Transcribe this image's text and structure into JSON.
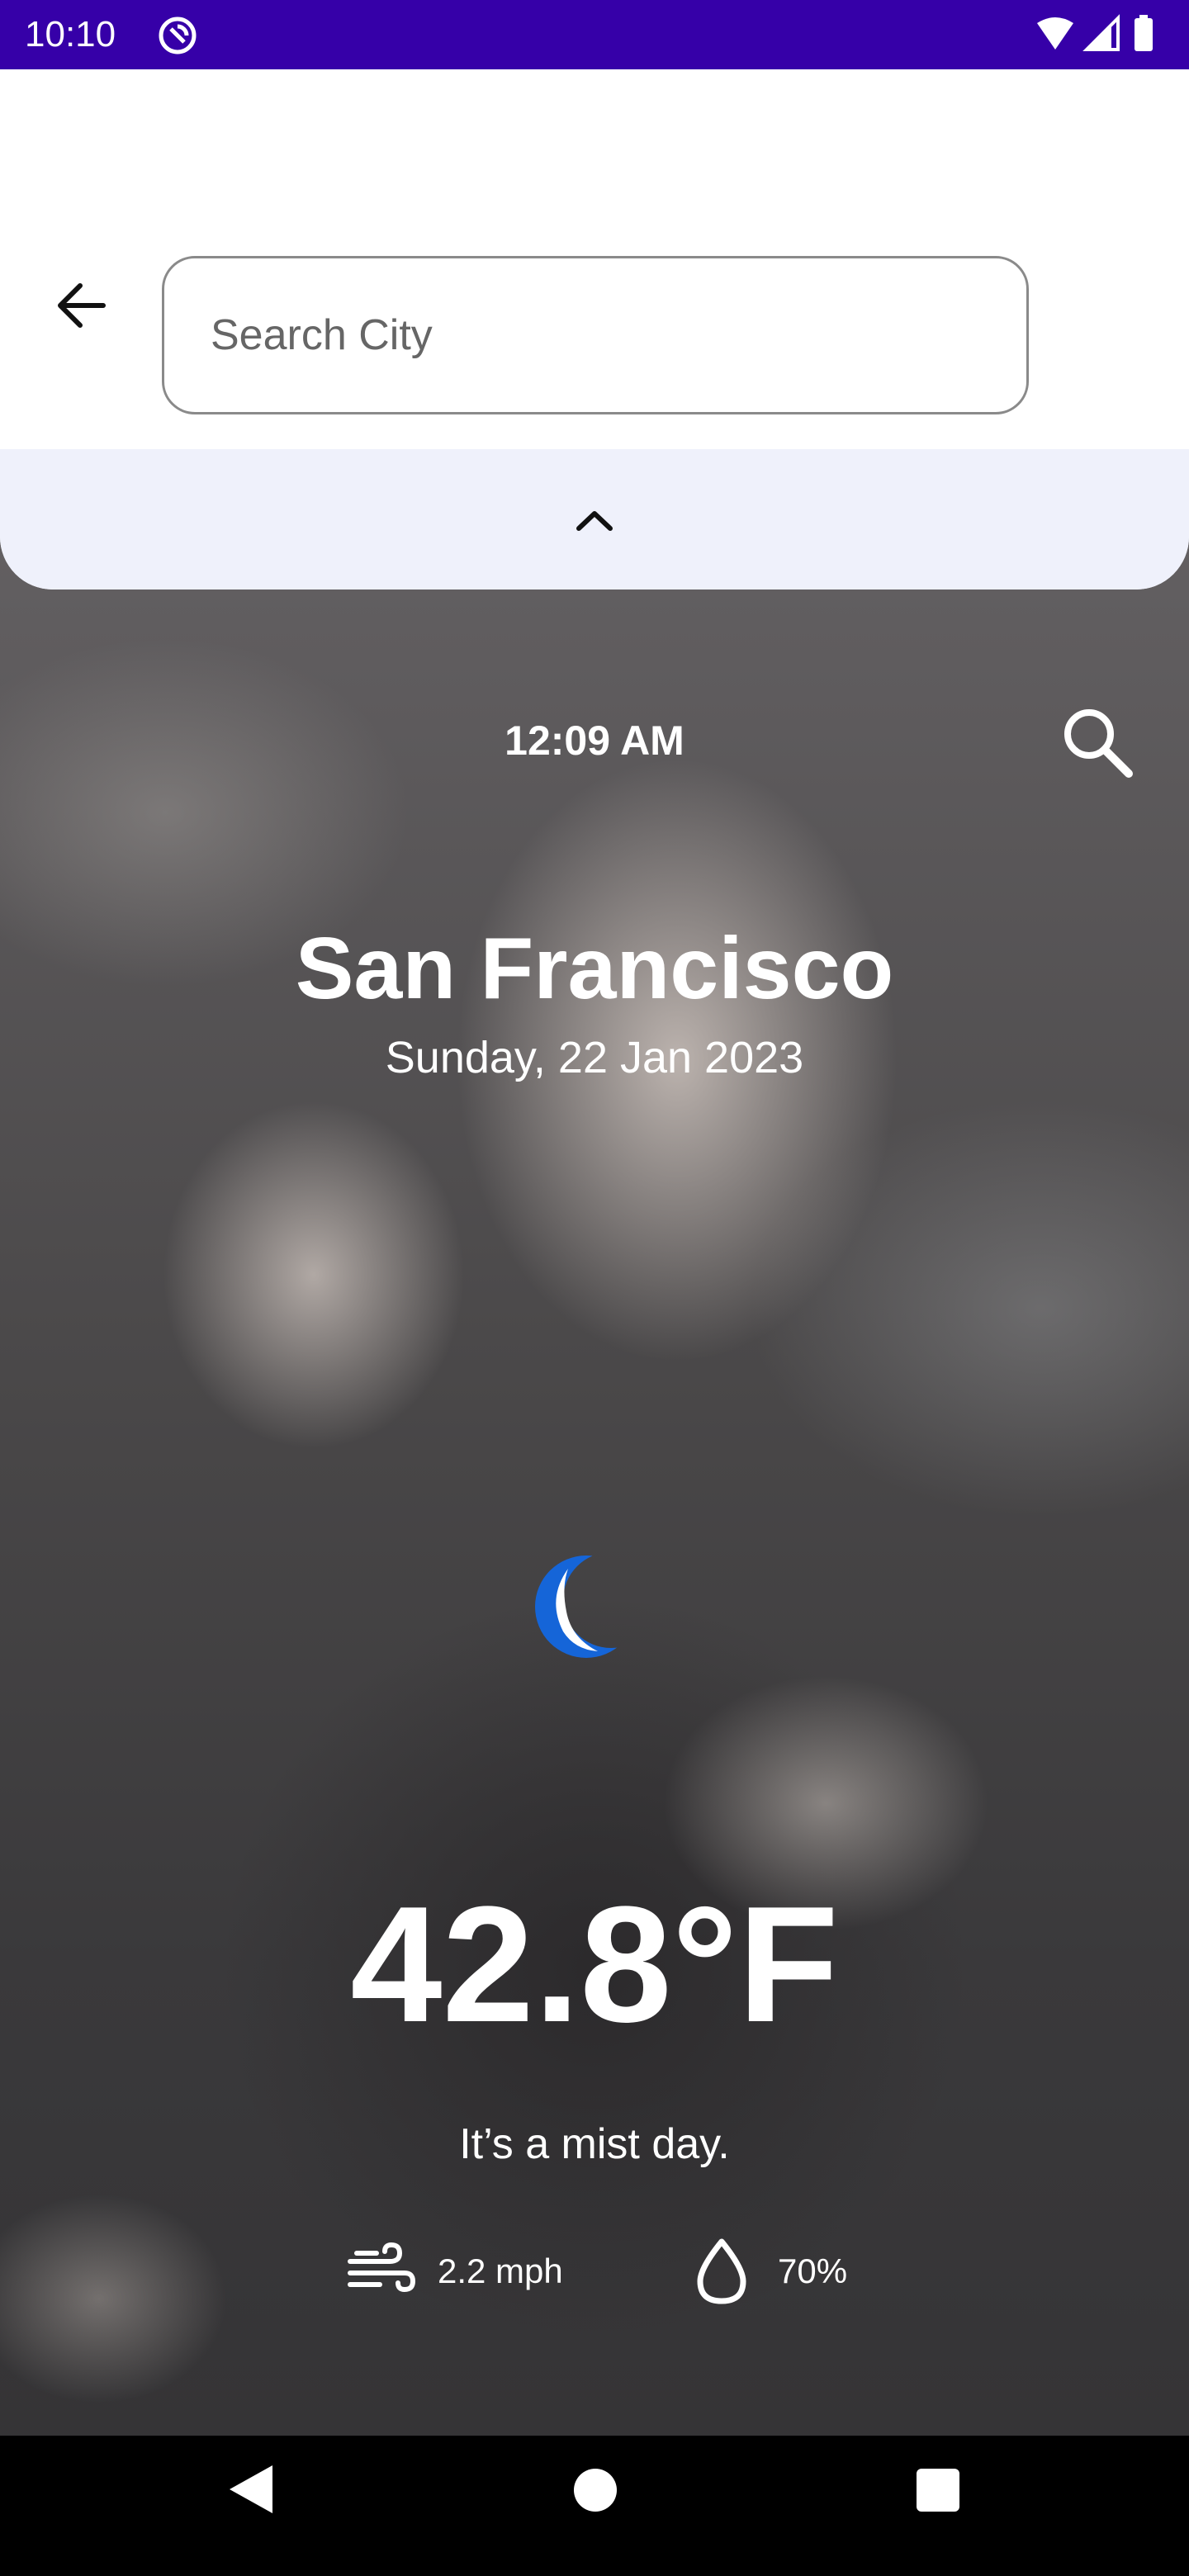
{
  "status_bar": {
    "time": "10:10",
    "background_color": "#3600a8"
  },
  "search": {
    "placeholder": "Search City",
    "value": ""
  },
  "weather": {
    "time": "12:09 AM",
    "city": "San Francisco",
    "date": "Sunday, 22 Jan 2023",
    "temperature": "42.8°F",
    "condition_text": "It’s a mist day.",
    "wind": "2.2 mph",
    "humidity": "70%",
    "condition_icon": "crescent-moon-icon",
    "accent_color": "#1565d8"
  },
  "icons": {
    "back": "arrow-left-icon",
    "search": "search-icon",
    "expand": "chevron-up-icon",
    "wind": "wind-icon",
    "humidity": "water-drop-icon"
  }
}
